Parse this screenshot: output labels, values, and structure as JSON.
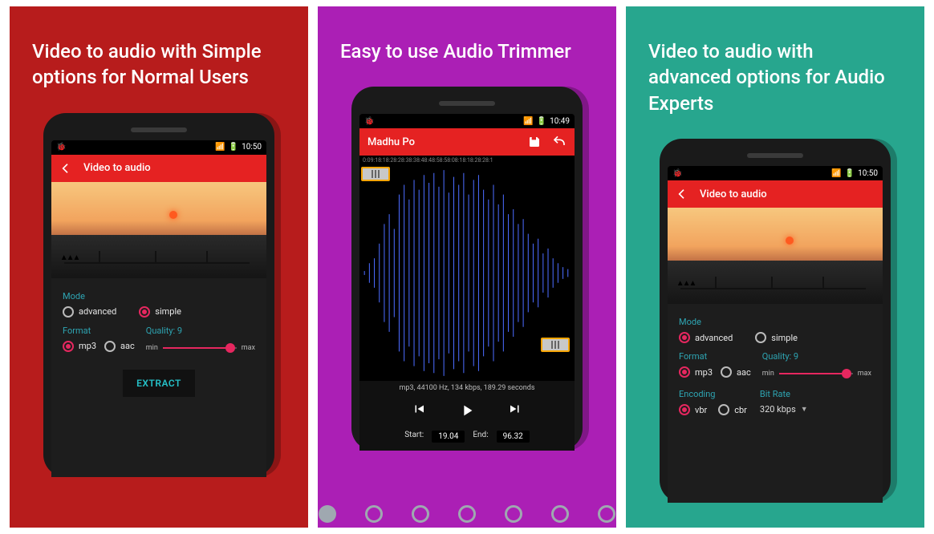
{
  "panels": {
    "left": {
      "headline": "Video to audio with Simple options for Normal Users"
    },
    "center": {
      "headline": "Easy to use Audio Trimmer"
    },
    "right": {
      "headline": "Video to audio with advanced options for Audio Experts"
    }
  },
  "status": {
    "time_left": "10:50",
    "time_center": "10:49",
    "time_right": "10:50"
  },
  "video_to_audio": {
    "title": "Video to audio",
    "mode_label": "Mode",
    "mode_advanced": "advanced",
    "mode_simple": "simple",
    "format_label": "Format",
    "format_mp3": "mp3",
    "format_aac": "aac",
    "quality_label": "Quality: 9",
    "slider_min": "min",
    "slider_max": "max",
    "extract": "EXTRACT",
    "encoding_label": "Encoding",
    "enc_vbr": "vbr",
    "enc_cbr": "cbr",
    "bitrate_label": "Bit Rate",
    "bitrate_value": "320 kbps"
  },
  "trimmer": {
    "title": "Madhu Po",
    "timeline": "0:09:18:18:28:28:38:38:48:48:58:58:08:18:18:28:28:1",
    "info": "mp3, 44100 Hz, 134 kbps, 189.29 seconds",
    "start_label": "Start:",
    "start_value": "19.04",
    "end_label": "End:",
    "end_value": "96.32"
  }
}
